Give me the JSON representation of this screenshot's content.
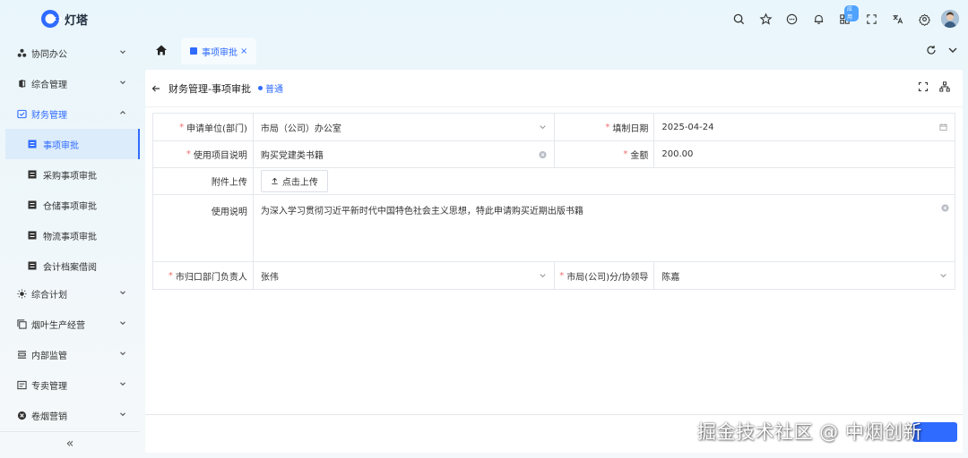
{
  "app": {
    "name": "灯塔"
  },
  "topbar": {
    "badge": "应用"
  },
  "sidebar": {
    "items": [
      {
        "label": "协同办公",
        "icon": "cluster-icon"
      },
      {
        "label": "综合管理",
        "icon": "office-icon"
      },
      {
        "label": "财务管理",
        "icon": "finance-icon",
        "open": true
      },
      {
        "label": "综合计划",
        "icon": "sun-icon"
      },
      {
        "label": "烟叶生产经营",
        "icon": "copy-icon"
      },
      {
        "label": "内部监管",
        "icon": "monitor-icon"
      },
      {
        "label": "专卖管理",
        "icon": "card-icon"
      },
      {
        "label": "卷烟营销",
        "icon": "marketing-icon"
      }
    ],
    "sub_items": [
      {
        "label": "事项审批",
        "active": true
      },
      {
        "label": "采购事项审批"
      },
      {
        "label": "仓储事项审批"
      },
      {
        "label": "物流事项审批"
      },
      {
        "label": "会计档案借阅"
      }
    ],
    "collapse": "«"
  },
  "tabs": [
    {
      "label": "事项审批",
      "close": "×"
    }
  ],
  "page": {
    "title": "财务管理-事项审批",
    "tag": "普通"
  },
  "form": {
    "apply_unit": {
      "label": "申请单位(部门)",
      "value": "市局（公司）办公室"
    },
    "fill_date": {
      "label": "填制日期",
      "value": "2025-04-24"
    },
    "project_desc": {
      "label": "使用项目说明",
      "value": "购买党建类书籍"
    },
    "amount": {
      "label": "金额",
      "value": "200.00"
    },
    "attachment": {
      "label": "附件上传",
      "button": "点击上传"
    },
    "usage_desc": {
      "label": "使用说明",
      "value": "为深入学习贯彻习近平新时代中国特色社会主义思想，特此申请购买近期出版书籍"
    },
    "dept_head": {
      "label": "市归口部门负责人",
      "value": "张伟"
    },
    "leader": {
      "label": "市局(公司)分/协领导",
      "value": "陈嘉"
    }
  },
  "watermark": "掘金技术社区 @ 中烟创新",
  "colors": {
    "accent": "#2f6bff",
    "required": "#f56c6c"
  }
}
